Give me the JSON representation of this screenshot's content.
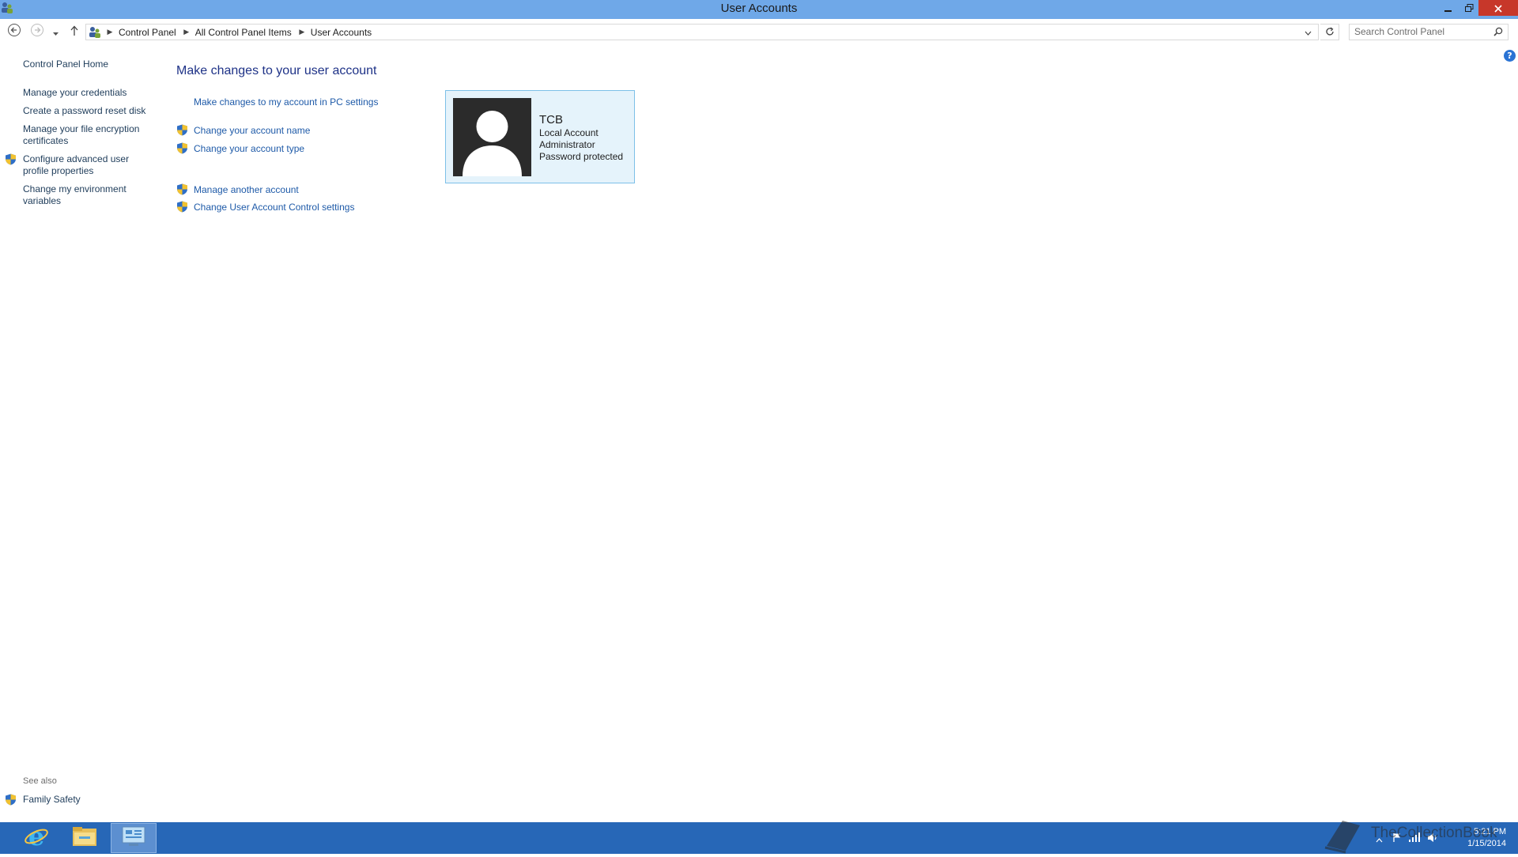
{
  "window": {
    "title": "User Accounts",
    "icons": {
      "app": "user-accounts-icon",
      "minimize": "minimize-icon",
      "maximize": "restore-icon",
      "close": "close-icon"
    }
  },
  "address_bar": {
    "crumbs": [
      "Control Panel",
      "All Control Panel Items",
      "User Accounts"
    ],
    "search_placeholder": "Search Control Panel"
  },
  "sidebar": {
    "home": "Control Panel Home",
    "items": [
      {
        "label": "Manage your credentials",
        "shield": false
      },
      {
        "label": "Create a password reset disk",
        "shield": false
      },
      {
        "label": "Manage your file encryption certificates",
        "shield": false
      },
      {
        "label": "Configure advanced user profile properties",
        "shield": true
      },
      {
        "label": "Change my environment variables",
        "shield": false
      }
    ],
    "see_also_label": "See also",
    "see_also_items": [
      "Family Safety"
    ]
  },
  "main": {
    "heading": "Make changes to your user account",
    "links": [
      "Make changes to my account in PC settings",
      "Change your account name",
      "Change your account type",
      "Manage another account",
      "Change User Account Control settings"
    ]
  },
  "account": {
    "name": "TCB",
    "type": "Local Account",
    "role": "Administrator",
    "status": "Password protected"
  },
  "taskbar": {
    "apps": [
      "internet-explorer-icon",
      "file-explorer-icon",
      "control-panel-icon"
    ],
    "clock_time": "5:21 PM",
    "clock_date": "1/15/2014"
  },
  "watermark": {
    "text": "TheCollectionBook"
  },
  "colors": {
    "titlebar": "#6fa8e8",
    "taskbar": "#2767b7",
    "link": "#1e5aa8",
    "tile_bg": "#e5f3fb",
    "tile_border": "#7dc0e8"
  }
}
